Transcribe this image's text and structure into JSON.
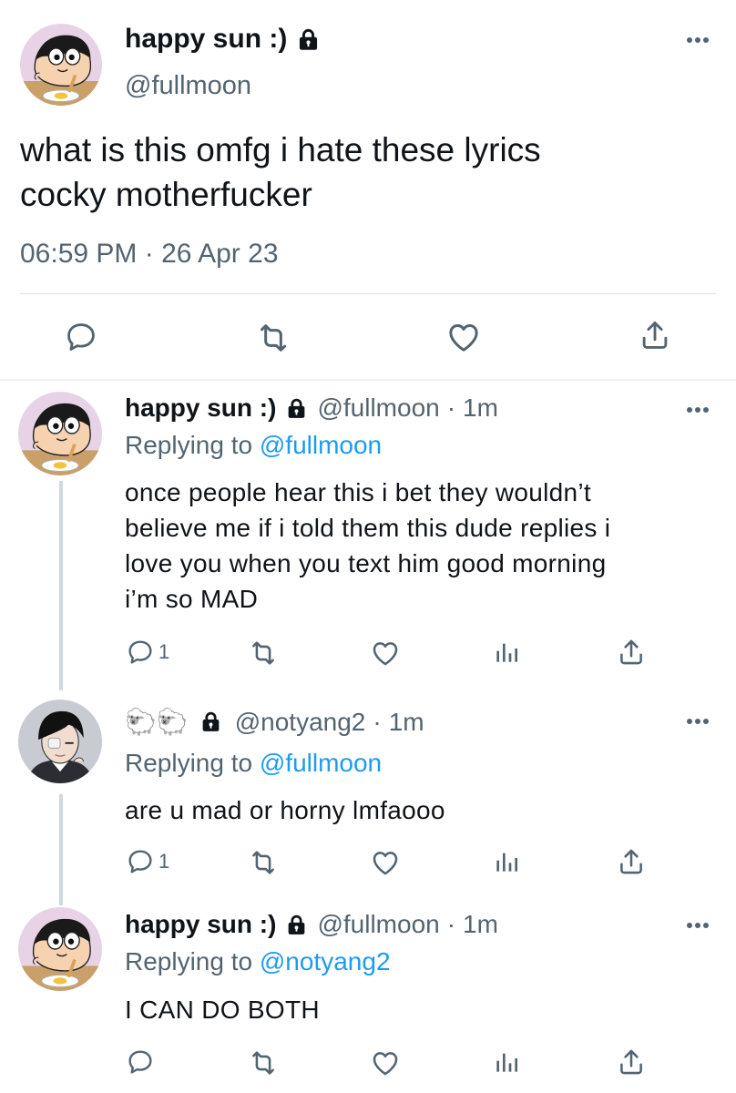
{
  "main_tweet": {
    "display_name": "happy sun :)",
    "handle": "@fullmoon",
    "text_line1": "what is this omfg i hate these lyrics",
    "text_line2": "cocky motherfucker",
    "meta": "06:59 PM · 26 Apr 23"
  },
  "replies": [
    {
      "display_name": "happy sun :)",
      "handle": "@fullmoon",
      "dot": "·",
      "time": "1m",
      "replying_prefix": "Replying to ",
      "replying_to": "@fullmoon",
      "lines": [
        "once people hear this i bet they wouldn’t",
        "believe me if i told them this dude replies i",
        "love you when you text him good morning",
        "i’m so MAD"
      ],
      "reply_count": "1"
    },
    {
      "display_name": "🐑🐑",
      "handle": "@notyang2",
      "dot": "·",
      "time": "1m",
      "replying_prefix": "Replying to ",
      "replying_to": "@fullmoon",
      "lines": [
        "are u mad or horny lmfaooo"
      ],
      "reply_count": "1"
    },
    {
      "display_name": "happy sun :)",
      "handle": "@fullmoon",
      "dot": "·",
      "time": "1m",
      "replying_prefix": "Replying to ",
      "replying_to": "@notyang2",
      "lines": [
        "I CAN DO BOTH"
      ]
    }
  ],
  "icons": {
    "reply": "reply-icon",
    "retweet": "retweet-icon",
    "like": "heart-icon",
    "views": "analytics-icon",
    "share": "share-icon",
    "more": "more-icon",
    "lock": "lock-icon"
  },
  "colors": {
    "link": "#1d9bf0",
    "secondary_text": "#536471",
    "thread_line": "#cfd9de",
    "icon": "#536471"
  }
}
